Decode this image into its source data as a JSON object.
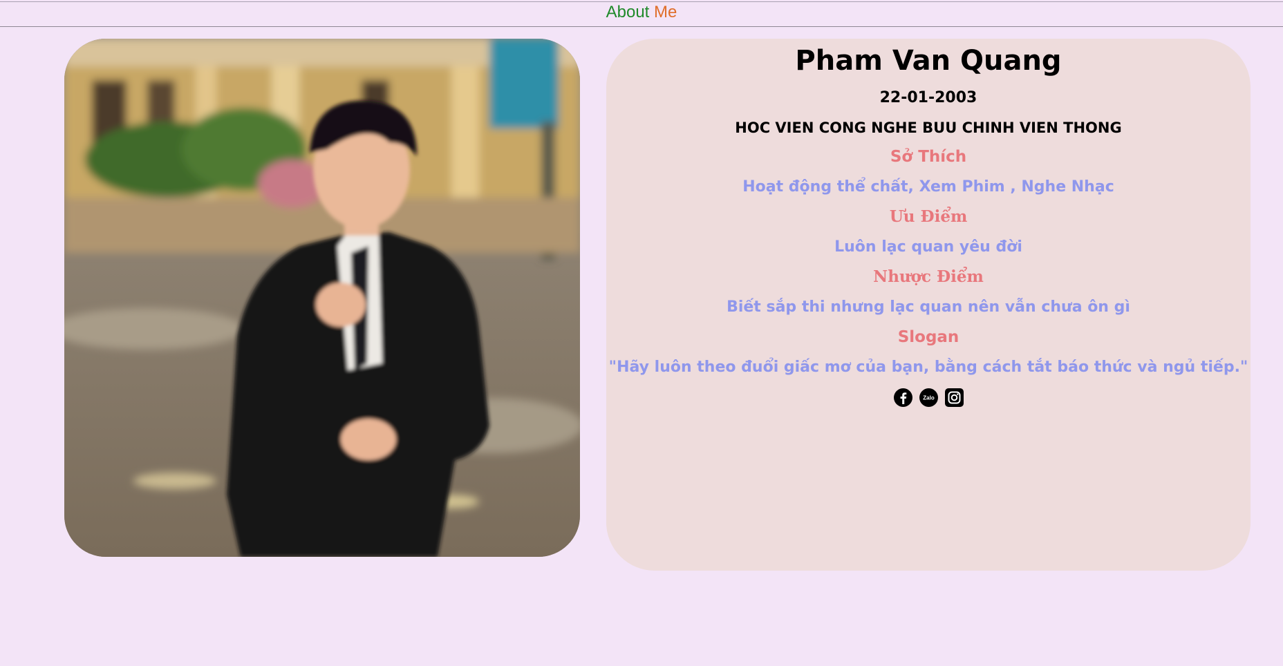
{
  "header": {
    "title_part1": "About",
    "title_part2": "Me"
  },
  "profile": {
    "name": "Pham Van Quang",
    "dob": "22-01-2003",
    "school": "HOC VIEN CONG NGHE BUU CHINH VIEN THONG",
    "sections": [
      {
        "title": "Sở Thích",
        "text": "Hoạt động thể chất, Xem Phim , Nghe Nhạc"
      },
      {
        "title": "Ưu Điểm",
        "text": "Luôn lạc quan yêu đời"
      },
      {
        "title": "Nhược Điểm",
        "text": "Biết sắp thi nhưng lạc quan nên vẫn chưa ôn gì"
      },
      {
        "title": "Slogan",
        "text": "\"Hãy luôn theo đuổi giấc mơ của bạn, bằng cách tắt báo thức và ngủ tiếp.\""
      }
    ]
  },
  "socials": {
    "facebook_icon": "facebook-icon",
    "zalo_icon": "zalo-icon",
    "zalo_label": "Zalo",
    "instagram_icon": "instagram-icon"
  },
  "colors": {
    "page_bg": "#f3e4f7",
    "card_bg": "#eedcdc",
    "title_green": "#1f8a2a",
    "title_orange": "#e06e2a",
    "section_title": "#e8777c",
    "section_text": "#8f97ec"
  }
}
